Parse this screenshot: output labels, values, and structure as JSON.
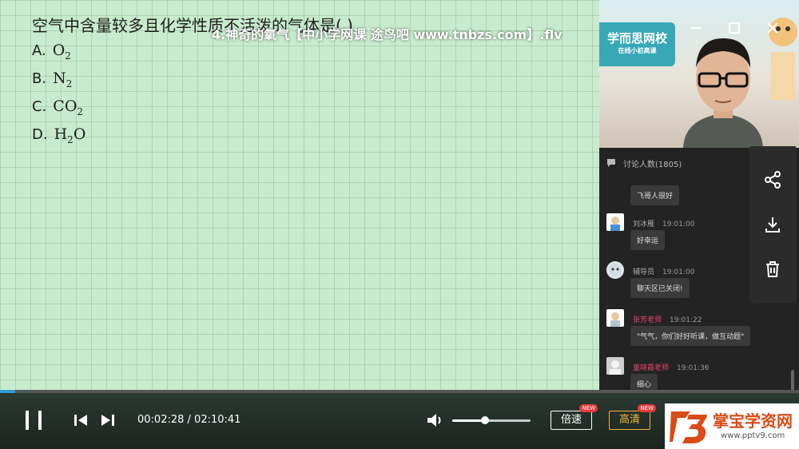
{
  "video": {
    "title": "4.神奇的氧气【中小学网课 途鸟吧 www.tnbzs.com】.flv",
    "progress": 0.0188
  },
  "board": {
    "question": "空气中含量较多且化学性质不活泼的气体是(     )",
    "options": [
      {
        "letter": "A.",
        "formula": "O",
        "sub": "2"
      },
      {
        "letter": "B.",
        "formula": "N",
        "sub": "2"
      },
      {
        "letter": "C.",
        "formula": "CO",
        "sub": "2"
      },
      {
        "letter": "D.",
        "formula": "H",
        "sub": "2",
        "tail": "O"
      }
    ]
  },
  "camera": {
    "logo": "学而思网校",
    "logo_sub": "在线小初高课"
  },
  "chat": {
    "header": "讨论人数(1805)",
    "messages": [
      {
        "name": "",
        "time": "",
        "text": "飞哥人很好"
      },
      {
        "name": "刘冰雁",
        "time": "19:01:00",
        "text": "好幸运",
        "role": "student"
      },
      {
        "name": "辅导员",
        "time": "19:01:00",
        "text": "聊天区已关闭!",
        "role": "assistant"
      },
      {
        "name": "张芳老师",
        "time": "19:01:22",
        "text": "\"气气，你们好好听课，做互动题\"",
        "role": "teacher"
      },
      {
        "name": "董晓霞老师",
        "time": "19:01:36",
        "text": "细心",
        "role": "teacher"
      }
    ]
  },
  "player": {
    "current_time": "00:02:28",
    "total_time": "02:10:41",
    "volume": 0.42,
    "speed_label": "倍速",
    "quality_label": "高清",
    "new_badge": "NEW"
  },
  "watermark": {
    "title": "掌宝学资网",
    "url": "www.pptv9.com"
  },
  "colors": {
    "board_bg": "#c9ebcd",
    "progress": "#2e9bd6",
    "teacher_name": "#e8456b",
    "watermark": "#d94b17"
  }
}
